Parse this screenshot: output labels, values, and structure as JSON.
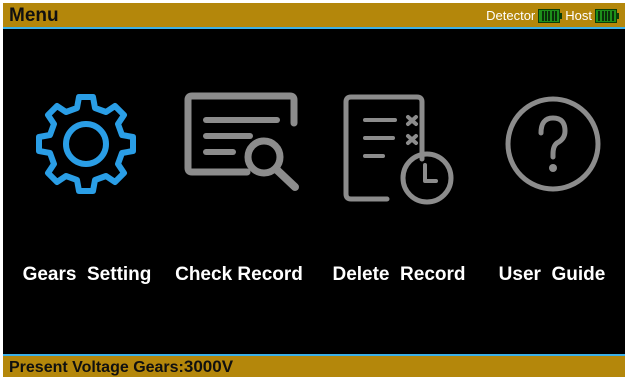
{
  "header": {
    "title": "Menu",
    "detector_label": "Detector",
    "host_label": "Host",
    "detector_battery_icon": "battery-full-icon",
    "host_battery_icon": "battery-full-icon"
  },
  "menu": {
    "items": [
      {
        "label": "Gears  Setting",
        "icon": "gear-icon",
        "highlighted": true
      },
      {
        "label": "Check Record",
        "icon": "document-search-icon",
        "highlighted": false
      },
      {
        "label": "Delete  Record",
        "icon": "document-delete-clock-icon",
        "highlighted": false
      },
      {
        "label": "User  Guide",
        "icon": "question-circle-icon",
        "highlighted": false
      }
    ]
  },
  "footer": {
    "label": "Present Voltage Gears:",
    "value": "3000V"
  },
  "colors": {
    "bar_background": "#b4870b",
    "bar_border": "#3cb0e8",
    "screen_background": "#000000",
    "icon_selected": "#2a9ee6",
    "icon_default": "#8c8c8c",
    "battery_green": "#1d8f1a",
    "label_text": "#ffffff"
  }
}
